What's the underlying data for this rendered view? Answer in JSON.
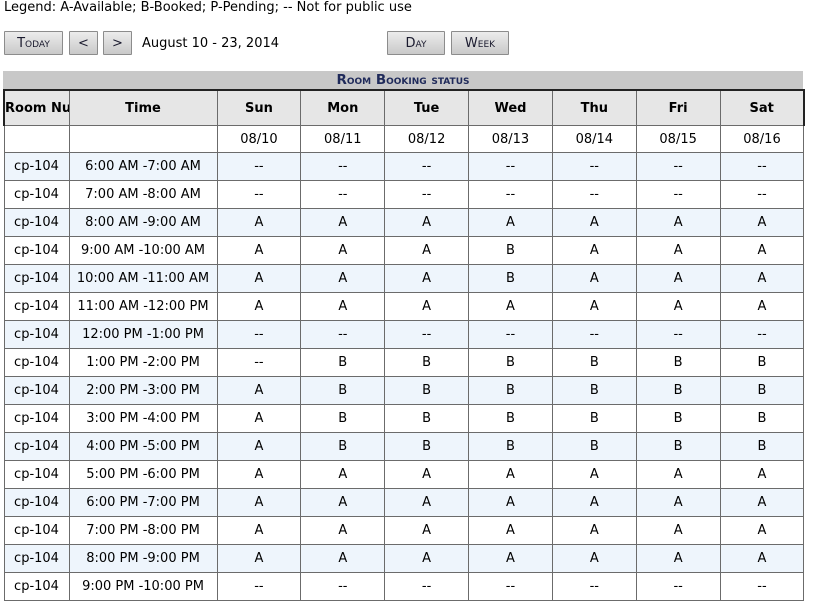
{
  "legend": "Legend: A-Available; B-Booked; P-Pending; -- Not for public use",
  "nav": {
    "today_label": "Today",
    "prev_label": "<",
    "next_label": ">",
    "range_label": "August 10 - 23, 2014",
    "day_label": "Day",
    "week_label": "Week"
  },
  "grid": {
    "title": "Room Booking status",
    "room_header": "Room Number",
    "time_header": "Time",
    "days": [
      "Sun",
      "Mon",
      "Tue",
      "Wed",
      "Thu",
      "Fri",
      "Sat"
    ],
    "dates": [
      "08/10",
      "08/11",
      "08/12",
      "08/13",
      "08/14",
      "08/15",
      "08/16"
    ],
    "rows": [
      {
        "room": "cp-104",
        "time": "6:00 AM -7:00 AM",
        "status": [
          "--",
          "--",
          "--",
          "--",
          "--",
          "--",
          "--"
        ]
      },
      {
        "room": "cp-104",
        "time": "7:00 AM -8:00 AM",
        "status": [
          "--",
          "--",
          "--",
          "--",
          "--",
          "--",
          "--"
        ]
      },
      {
        "room": "cp-104",
        "time": "8:00 AM -9:00 AM",
        "status": [
          "A",
          "A",
          "A",
          "A",
          "A",
          "A",
          "A"
        ]
      },
      {
        "room": "cp-104",
        "time": "9:00 AM -10:00 AM",
        "status": [
          "A",
          "A",
          "A",
          "B",
          "A",
          "A",
          "A"
        ]
      },
      {
        "room": "cp-104",
        "time": "10:00 AM -11:00 AM",
        "status": [
          "A",
          "A",
          "A",
          "B",
          "A",
          "A",
          "A"
        ]
      },
      {
        "room": "cp-104",
        "time": "11:00 AM -12:00 PM",
        "status": [
          "A",
          "A",
          "A",
          "A",
          "A",
          "A",
          "A"
        ]
      },
      {
        "room": "cp-104",
        "time": "12:00 PM -1:00 PM",
        "status": [
          "--",
          "--",
          "--",
          "--",
          "--",
          "--",
          "--"
        ]
      },
      {
        "room": "cp-104",
        "time": "1:00 PM -2:00 PM",
        "status": [
          "--",
          "B",
          "B",
          "B",
          "B",
          "B",
          "B"
        ]
      },
      {
        "room": "cp-104",
        "time": "2:00 PM -3:00 PM",
        "status": [
          "A",
          "B",
          "B",
          "B",
          "B",
          "B",
          "B"
        ]
      },
      {
        "room": "cp-104",
        "time": "3:00 PM -4:00 PM",
        "status": [
          "A",
          "B",
          "B",
          "B",
          "B",
          "B",
          "B"
        ]
      },
      {
        "room": "cp-104",
        "time": "4:00 PM -5:00 PM",
        "status": [
          "A",
          "B",
          "B",
          "B",
          "B",
          "B",
          "B"
        ]
      },
      {
        "room": "cp-104",
        "time": "5:00 PM -6:00 PM",
        "status": [
          "A",
          "A",
          "A",
          "A",
          "A",
          "A",
          "A"
        ]
      },
      {
        "room": "cp-104",
        "time": "6:00 PM -7:00 PM",
        "status": [
          "A",
          "A",
          "A",
          "A",
          "A",
          "A",
          "A"
        ]
      },
      {
        "room": "cp-104",
        "time": "7:00 PM -8:00 PM",
        "status": [
          "A",
          "A",
          "A",
          "A",
          "A",
          "A",
          "A"
        ]
      },
      {
        "room": "cp-104",
        "time": "8:00 PM -9:00 PM",
        "status": [
          "A",
          "A",
          "A",
          "A",
          "A",
          "A",
          "A"
        ]
      },
      {
        "room": "cp-104",
        "time": "9:00 PM -10:00 PM",
        "status": [
          "--",
          "--",
          "--",
          "--",
          "--",
          "--",
          "--"
        ]
      }
    ]
  }
}
